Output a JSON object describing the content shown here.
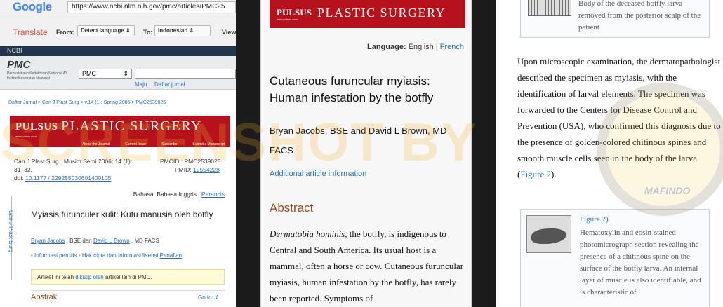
{
  "panel1": {
    "browser": {
      "logo": "Google",
      "url": "https://www.ncbi.nlm.nih.gov/pmc/articles/PMC25"
    },
    "translate": {
      "title": "Translate",
      "from_label": "From:",
      "from_value": "Detect language",
      "to_label": "To:",
      "to_value": "Indonesian",
      "view_label": "View:"
    },
    "ncbi": "NCBI",
    "pmc": {
      "logo": "PMC",
      "sub": "Perpustakaan Kedokteran Nasional AS Institut Kesehatan Nasional",
      "db_select": "PMC",
      "link1": "Maju",
      "link2": "Daftar jurnal"
    },
    "breadcrumb": "Daftar Jurnal > Can J Plast Surg > v.14 (1); Spring 2006 > PMC2539025",
    "banner": {
      "logo1": "PULSUS",
      "logo2": "PLASTIC SURGERY",
      "site": "www.pulsus.com",
      "nav": [
        "About the Journal",
        "Current Issue",
        "Subscribe",
        "Submit a Manuscript"
      ]
    },
    "citation": {
      "line1": "Can J Plast Surg . Musim Semi 2006; 14 (1):",
      "line2": "31–32.",
      "doi_label": "doi: ",
      "doi": "10.1177 / 229255030601400105",
      "pmcid": "PMCID : PMC2539025",
      "pmid_label": "PMID: ",
      "pmid": "19554228"
    },
    "language": {
      "label": "Bahasa: Bahasa Inggris | ",
      "alt": "Perancis"
    },
    "side_label": "Can J Plast Surg",
    "title": "Myiasis furunculer kulit: Kutu manusia oleh botfly",
    "authors": {
      "a1": "Bryan Jacobs",
      "mid": " , BSE dan ",
      "a2": "David L Brown",
      "end": " , MD FACS"
    },
    "info": {
      "i1": "Informasi penulis",
      "i2": "Hak cipta dan Informasi lisensi",
      "i3": "Penafian"
    },
    "note": {
      "pre": "Artikel ini telah ",
      "link": "dikutip oleh",
      "post": " artikel lain di PMC."
    },
    "abstract": "Abstrak",
    "goto": "Go to:"
  },
  "panel2": {
    "banner": {
      "logo1": "PULSUS",
      "logo2": "PLASTIC SURGERY",
      "site": "www.pulsus.com"
    },
    "language": {
      "label": "Language:",
      "en": "English",
      "sep": "|",
      "fr": "French"
    },
    "title": "Cutaneous furuncular myiasis: Human infestation by the botfly",
    "authors": "Bryan Jacobs, BSE and David L Brown, MD FACS",
    "additional": "Additional article information",
    "abstract": "Abstract",
    "body_italic": "Dermatobia hominis",
    "body": ", the botfly, is indigenous to Central and South America. Its usual host is a mammal, often a horse or cow. Cutaneous furuncular myiasis, human infestation by the botfly, has rarely been reported. Symptoms of"
  },
  "panel3": {
    "fig1_caption": "Body of the deceased botfly larva removed from the posterior scalp of the patient",
    "body": "Upon microscopic examination, the dermatopathologist described the specimen as myiasis, with the identification of larval elements. The specimen was forwarded to the Centers for Disease Control and Prevention (USA), who confirmed this diagnosis due to the presence of golden-colored chitinous spines and smooth muscle cells seen in the body of the larva (",
    "body_link": "Figure 2",
    "body_end": ").",
    "fig2_title": "Figure 2)",
    "fig2_caption": "Hematoxylin and eosin-stained photomicrograph section revealing the presence of a chitinous spine on the surface of the botfly larva. An internal layer of muscle is also identifiable, and is characteristic of"
  },
  "watermark": {
    "text": "SCREENSHOT BY",
    "seal": "MAFINDO"
  }
}
